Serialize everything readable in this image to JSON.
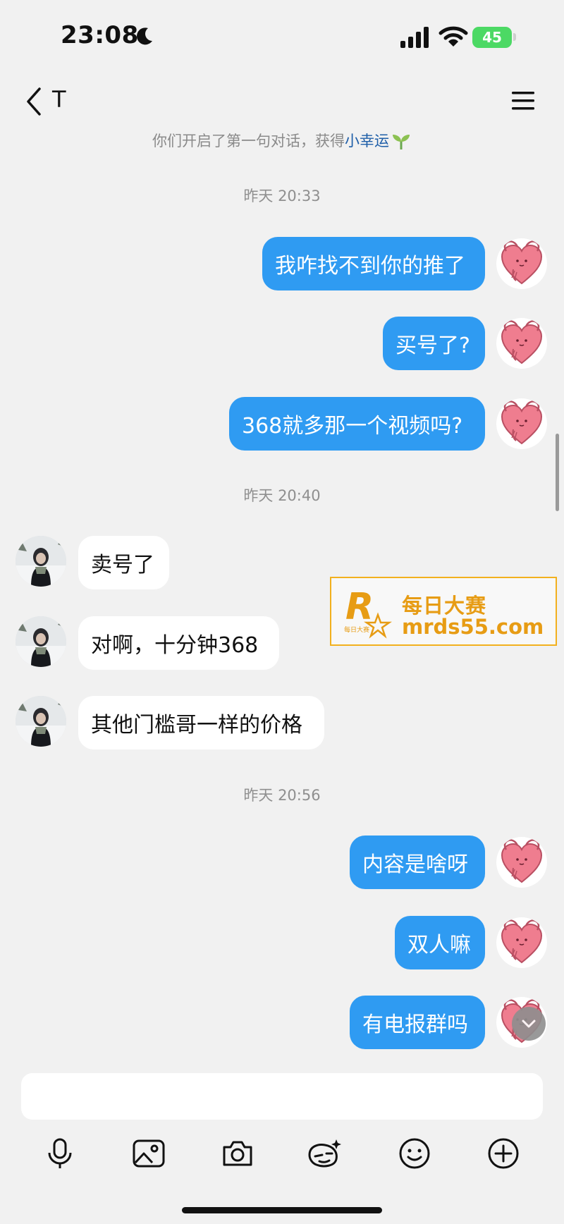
{
  "status_bar": {
    "time": "23:08",
    "battery": "45"
  },
  "nav": {
    "title": "T"
  },
  "notice": {
    "text": "你们开启了第一句对话，获得",
    "highlight": "小幸运"
  },
  "timestamps": [
    "昨天 20:33",
    "昨天 20:40",
    "昨天 20:56"
  ],
  "messages": [
    {
      "dir": "out",
      "text": "我咋找不到你的推了"
    },
    {
      "dir": "out",
      "text": "买号了?"
    },
    {
      "dir": "out",
      "text": "368就多那一个视频吗?"
    },
    {
      "dir": "in",
      "text": "卖号了"
    },
    {
      "dir": "in",
      "text": "对啊，十分钟368"
    },
    {
      "dir": "in",
      "text": "其他门槛哥一样的价格"
    },
    {
      "dir": "out",
      "text": "内容是啥呀"
    },
    {
      "dir": "out",
      "text": "双人嘛"
    },
    {
      "dir": "out",
      "text": "有电报群吗"
    }
  ],
  "watermark": {
    "title": "每日大赛",
    "url": "mrds55.com",
    "logo_letter": "R",
    "logo_small": "每日大赛"
  },
  "composer": {
    "placeholder": ""
  },
  "toolbar": [
    "microphone-icon",
    "image-icon",
    "camera-icon",
    "sticker-icon",
    "emoji-icon",
    "plus-icon"
  ],
  "colors": {
    "outgoing_bubble": "#2f9bf2",
    "incoming_bubble": "#ffffff",
    "background": "#f1f1f1",
    "watermark": "#e79c14"
  }
}
